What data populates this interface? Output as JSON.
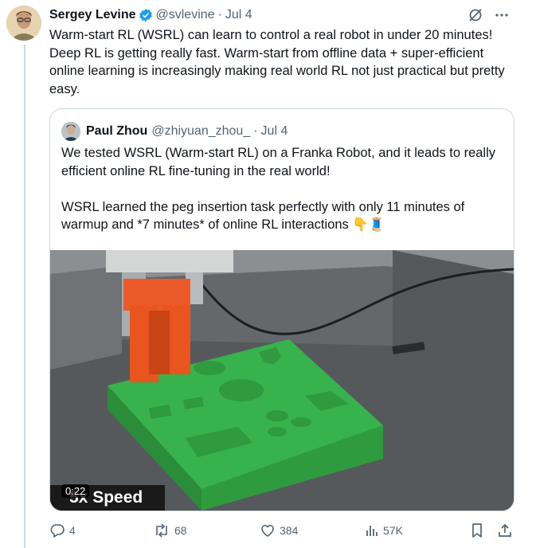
{
  "tweet": {
    "author_name": "Sergey Levine",
    "author_handle": "@svlevine",
    "separator": "·",
    "date": "Jul 4",
    "text": "Warm-start RL (WSRL) can learn to control a real robot in under 20 minutes! Deep RL is getting really fast. Warm-start from offline data + super-efficient online learning is increasingly making real world RL not just practical but pretty easy."
  },
  "quoted_tweet": {
    "author_name": "Paul Zhou",
    "author_handle": "@zhiyuan_zhou_",
    "separator": "·",
    "date": "Jul 4",
    "paragraph1": "We tested WSRL (Warm-start RL) on a Franka Robot, and it leads to really efficient online RL fine-tuning in the real world!",
    "paragraph2": "WSRL learned the peg insertion task perfectly with only 11 minutes of warmup and *7 minutes* of online RL interactions 👇🧵",
    "video": {
      "overlay_text": "5x Speed",
      "time": "0:22"
    }
  },
  "actions": {
    "replies": "4",
    "reposts": "68",
    "likes": "384",
    "views": "57K"
  },
  "colors": {
    "verified": "#1d9bf0",
    "text": "#0f1419",
    "muted": "#536471",
    "border": "#cfd9de"
  },
  "icons": [
    "verified-badge-icon",
    "grok-icon",
    "more-icon",
    "reply-icon",
    "repost-icon",
    "like-icon",
    "views-icon",
    "bookmark-icon",
    "share-icon"
  ]
}
